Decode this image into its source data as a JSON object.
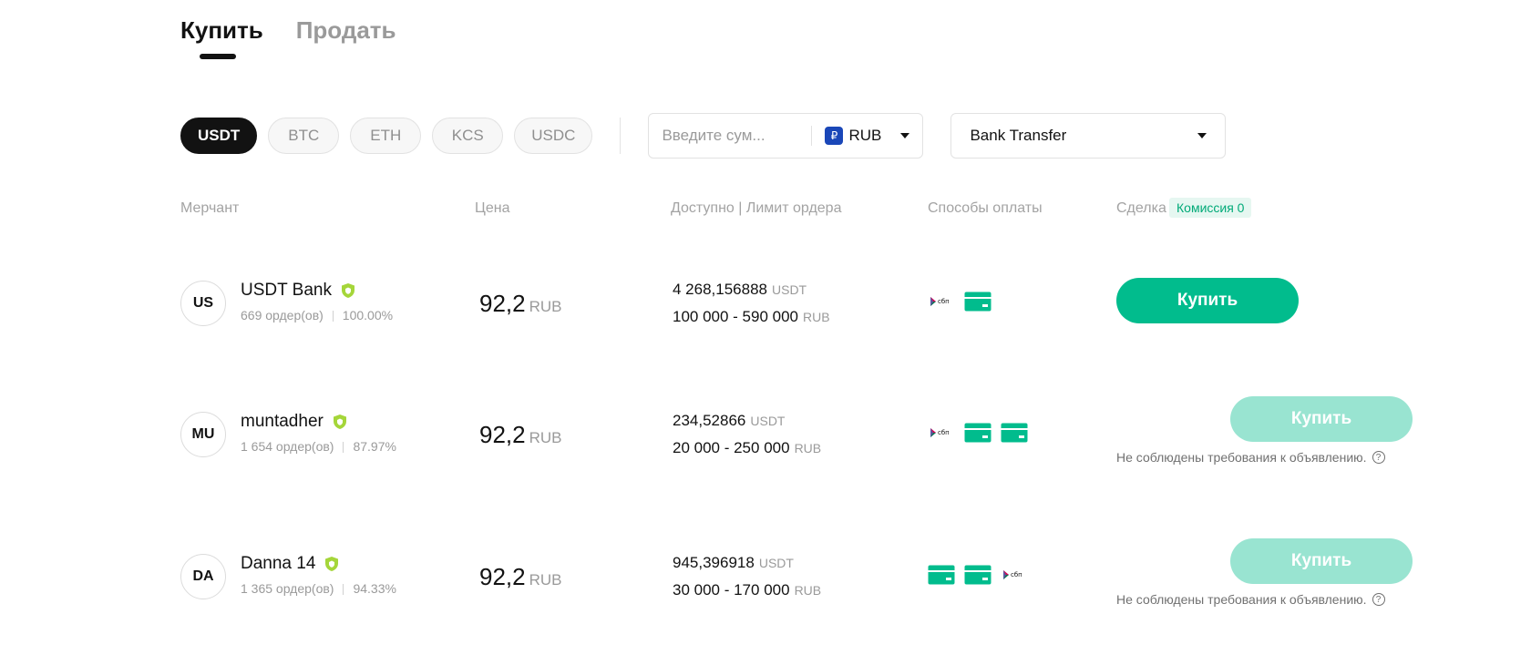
{
  "tabs": [
    {
      "label": "Купить",
      "active": true
    },
    {
      "label": "Продать",
      "active": false
    }
  ],
  "coins": [
    {
      "label": "USDT",
      "active": true
    },
    {
      "label": "BTC",
      "active": false
    },
    {
      "label": "ETH",
      "active": false
    },
    {
      "label": "KCS",
      "active": false
    },
    {
      "label": "USDC",
      "active": false
    }
  ],
  "amount": {
    "placeholder": "Введите сум...",
    "currency": "RUB",
    "currency_symbol": "₽"
  },
  "payment_filter": {
    "selected": "Bank Transfer"
  },
  "table_headers": {
    "merchant": "Мерчант",
    "price": "Цена",
    "available": "Доступно | Лимит ордера",
    "methods": "Способы оплаты",
    "deal": "Сделка",
    "fee_badge": "Комиссия 0"
  },
  "colors": {
    "accent": "#01bc8d",
    "accent_disabled": "#99e4d1",
    "verified": "#a5d63a"
  },
  "rows": [
    {
      "initials": "US",
      "name": "USDT Bank",
      "orders": "669 ордер(ов)",
      "completion": "100.00%",
      "price": "92,2",
      "price_currency": "RUB",
      "available": "4 268,156888",
      "available_unit": "USDT",
      "limit": "100 000 - 590 000",
      "limit_unit": "RUB",
      "methods": [
        "sbp-icon",
        "bank-card-icon"
      ],
      "button": "Купить",
      "enabled": true,
      "warning": ""
    },
    {
      "initials": "MU",
      "name": "muntadher",
      "orders": "1 654 ордер(ов)",
      "completion": "87.97%",
      "price": "92,2",
      "price_currency": "RUB",
      "available": "234,52866",
      "available_unit": "USDT",
      "limit": "20 000 - 250 000",
      "limit_unit": "RUB",
      "methods": [
        "sbp-icon",
        "bank-card-icon",
        "bank-card-icon"
      ],
      "button": "Купить",
      "enabled": false,
      "warning": "Не соблюдены требования к объявлению."
    },
    {
      "initials": "DA",
      "name": "Danna 14",
      "orders": "1 365 ордер(ов)",
      "completion": "94.33%",
      "price": "92,2",
      "price_currency": "RUB",
      "available": "945,396918",
      "available_unit": "USDT",
      "limit": "30 000 - 170 000",
      "limit_unit": "RUB",
      "methods": [
        "bank-card-icon",
        "bank-card-icon",
        "sbp-icon"
      ],
      "button": "Купить",
      "enabled": false,
      "warning": "Не соблюдены требования к объявлению."
    }
  ]
}
